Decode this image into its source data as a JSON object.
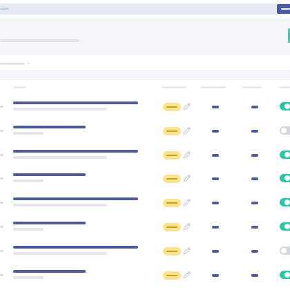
{
  "topbar": {
    "crumb": "",
    "primary_action": ""
  },
  "header": {
    "title": "",
    "subtitle": ""
  },
  "filter": {
    "selected": ""
  },
  "table": {
    "columns": [
      "",
      "",
      "",
      "",
      ""
    ],
    "rows": [
      {
        "title": "",
        "subtitle": "",
        "status": "",
        "toggle_on": true
      },
      {
        "title": "",
        "subtitle": "",
        "status": "",
        "toggle_on": false
      },
      {
        "title": "",
        "subtitle": "",
        "status": "",
        "toggle_on": true
      },
      {
        "title": "",
        "subtitle": "",
        "status": "",
        "toggle_on": true
      },
      {
        "title": "",
        "subtitle": "",
        "status": "",
        "toggle_on": true
      },
      {
        "title": "",
        "subtitle": "",
        "status": "",
        "toggle_on": true
      },
      {
        "title": "",
        "subtitle": "",
        "status": "",
        "toggle_on": false
      },
      {
        "title": "",
        "subtitle": "",
        "status": "",
        "toggle_on": true
      }
    ]
  },
  "icons": {
    "edit": "pencil-icon",
    "filter": "chevron-down-icon"
  },
  "colors": {
    "primary": "#4a5aa3",
    "accent": "#23c9a6",
    "status_badge": "#fbe28c",
    "background_panel": "#f5f6fa"
  }
}
